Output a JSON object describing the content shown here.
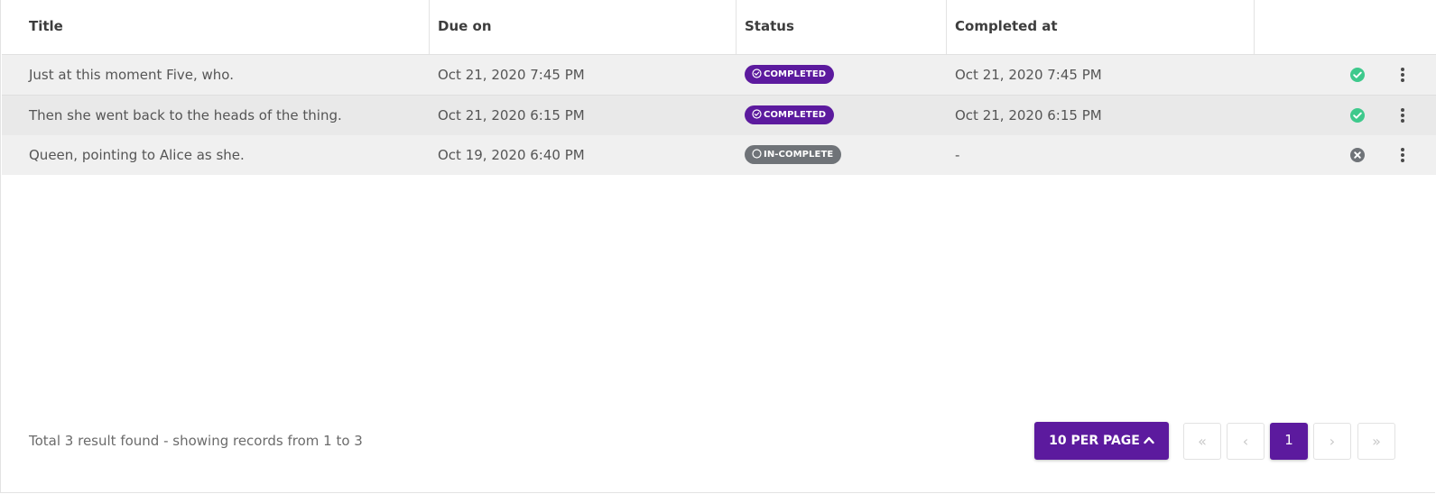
{
  "colors": {
    "accent": "#5c1a9e",
    "completed_badge": "#5c1a9e",
    "incomplete_badge": "#6f7378",
    "check_green": "#3ec98c",
    "cross_gray": "#6f7378"
  },
  "table": {
    "headers": [
      "Title",
      "Due on",
      "Status",
      "Completed at",
      ""
    ],
    "rows": [
      {
        "title": "Just at this moment Five, who.",
        "due_on": "Oct 21, 2020 7:45 PM",
        "status": "COMPLETED",
        "status_icon": "check-circle-icon",
        "completed_at": "Oct 21, 2020 7:45 PM",
        "state_icon": "green-check-circle-icon",
        "menu_icon": "more-vertical-icon"
      },
      {
        "title": "Then she went back to the heads of the thing.",
        "due_on": "Oct 21, 2020 6:15 PM",
        "status": "COMPLETED",
        "status_icon": "check-circle-icon",
        "completed_at": "Oct 21, 2020 6:15 PM",
        "state_icon": "green-check-circle-icon",
        "menu_icon": "more-vertical-icon"
      },
      {
        "title": "Queen, pointing to Alice as she.",
        "due_on": "Oct 19, 2020 6:40 PM",
        "status": "IN-COMPLETE",
        "status_icon": "circle-outline-icon",
        "completed_at": "-",
        "state_icon": "gray-x-circle-icon",
        "menu_icon": "more-vertical-icon"
      }
    ]
  },
  "footer": {
    "summary": "Total 3 result found - showing records from 1 to 3",
    "per_page_label": "10 PER PAGE",
    "per_page_icon": "chevron-up-icon",
    "pagination": {
      "first": "«",
      "prev": "‹",
      "current": "1",
      "next": "›",
      "last": "»"
    }
  }
}
